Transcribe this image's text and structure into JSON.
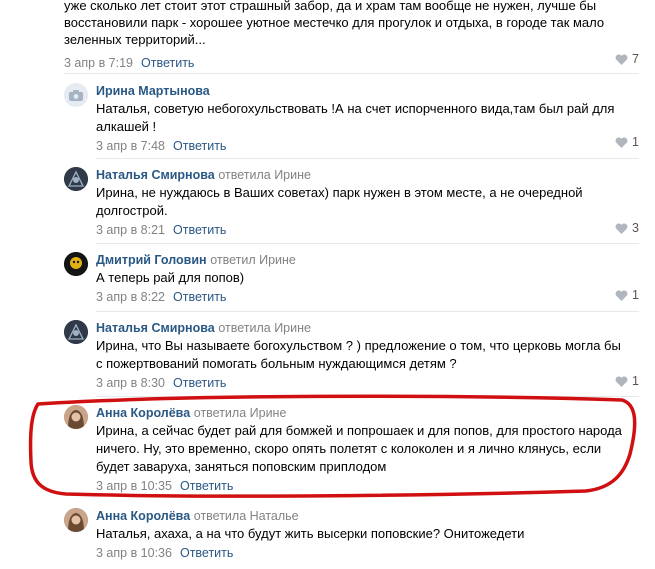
{
  "top_comment": {
    "text": "уже сколько лет стоит этот страшный забор, да и храм там вообще не нужен, лучше бы восстановили парк - хорошее уютное местечко для прогулок и отдыха, в городе так мало зеленных территорий...",
    "date": "3 апр в 7:19",
    "reply_label": "Ответить",
    "likes": "7"
  },
  "replies": [
    {
      "author": "Ирина Мартынова",
      "replied_to": "",
      "text": "Наталья, советую небогохульствовать !А на счет испорченного вида,там был рай для алкашей !",
      "date": "3 апр в 7:48",
      "reply_label": "Ответить",
      "likes": "1"
    },
    {
      "author": "Наталья Смирнова",
      "replied_to": "ответила Ирине",
      "text": "Ирина, не нуждаюсь в Ваших советах) парк нужен в этом месте, а не очередной долгострой.",
      "date": "3 апр в 8:21",
      "reply_label": "Ответить",
      "likes": "3"
    },
    {
      "author": "Дмитрий Головин",
      "replied_to": "ответил Ирине",
      "text": "А теперь рай для попов)",
      "date": "3 апр в 8:22",
      "reply_label": "Ответить",
      "likes": "1"
    },
    {
      "author": "Наталья Смирнова",
      "replied_to": "ответила Ирине",
      "text": "Ирина, что Вы называете богохульством ? ) предложение о том, что церковь могла бы с пожертвований помогать больным нуждающимся детям ?",
      "date": "3 апр в 8:30",
      "reply_label": "Ответить",
      "likes": "1"
    },
    {
      "author": "Анна Королёва",
      "replied_to": "ответила Ирине",
      "text": "Ирина, а сейчас будет рай для бомжей и попрошаек и для попов, для простого народа ничего. Ну, это временно, скоро опять полетят с колоколен и я лично клянусь, если будет заваруха, заняться поповским приплодом",
      "date": "3 апр в 10:35",
      "reply_label": "Ответить",
      "likes": ""
    },
    {
      "author": "Анна Королёва",
      "replied_to": "ответила Наталье",
      "text": "Наталья, ахаха, а на что будут жить высерки поповские? Онитожедети",
      "date": "3 апр в 10:36",
      "reply_label": "Ответить",
      "likes": ""
    }
  ],
  "colors": {
    "link": "#2a5885",
    "meta": "#828282",
    "highlight": "#d01010"
  },
  "icons": [
    "heart-icon",
    "camera-icon"
  ]
}
